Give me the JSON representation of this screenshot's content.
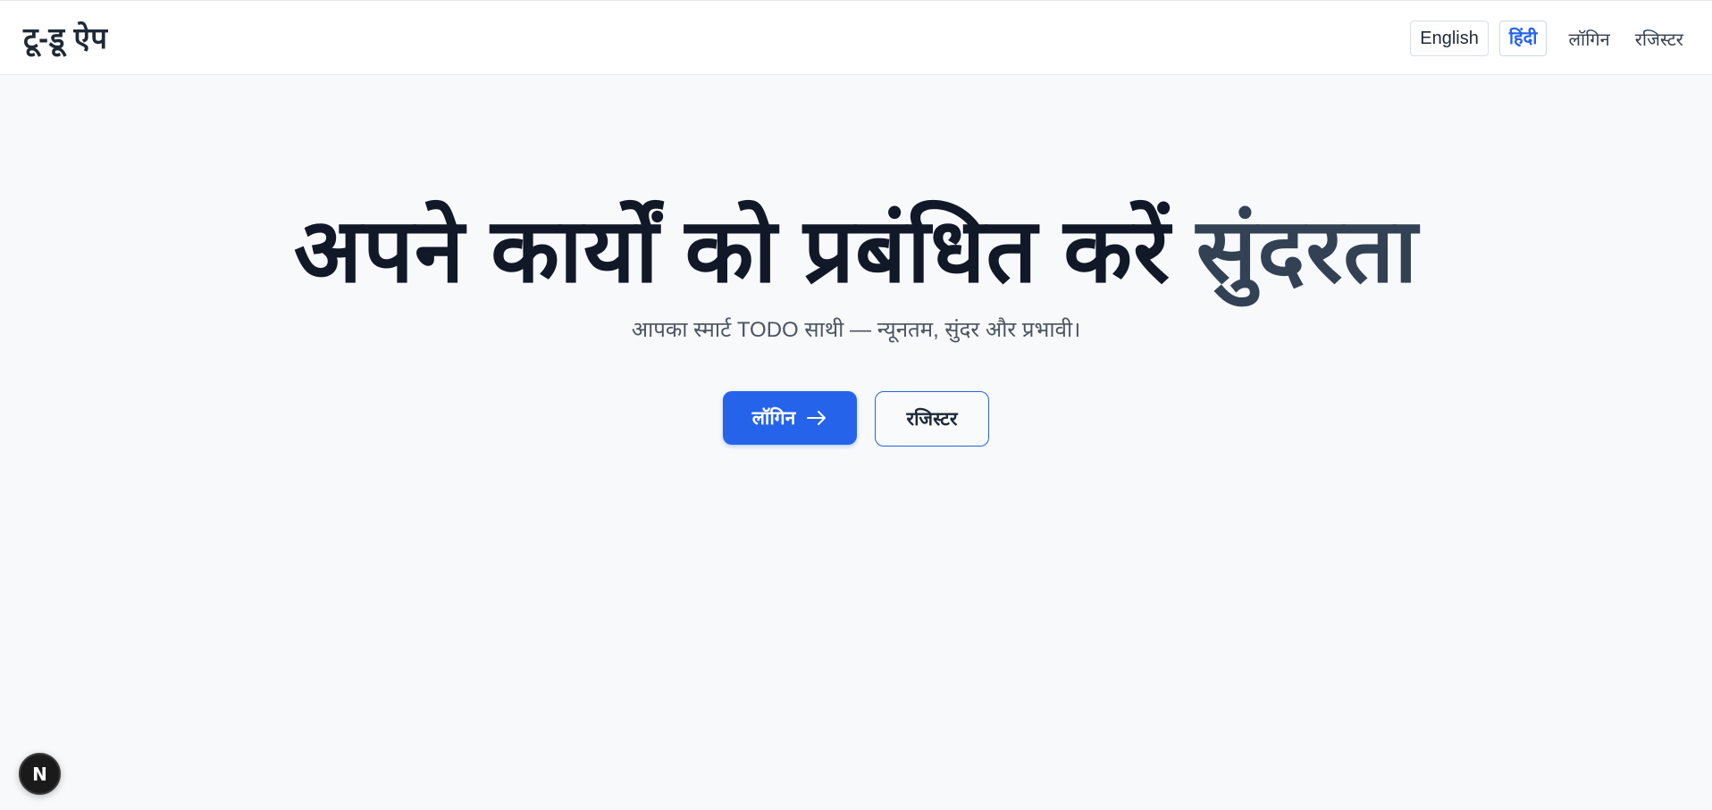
{
  "navbar": {
    "brand": "टू-डू ऐप",
    "lang_english": "English",
    "lang_hindi": "हिंदी",
    "login_link": "लॉगिन",
    "register_link": "रजिस्टर"
  },
  "hero": {
    "title_main": "अपने कार्यों को प्रबंधित करें",
    "title_accent": "सुंदरता",
    "subtitle": "आपका स्मार्ट TODO साथी — न्यूनतम, सुंदर और प्रभावी।",
    "login_button": "लॉगिन",
    "register_button": "रजिस्टर"
  },
  "badge": {
    "letter": "N"
  },
  "icons": {
    "login_button_icon": "arrow-right-icon"
  },
  "colors": {
    "primary": "#2563eb",
    "title": "#111827",
    "accent_title": "#334155",
    "background": "#f8f9fb"
  }
}
